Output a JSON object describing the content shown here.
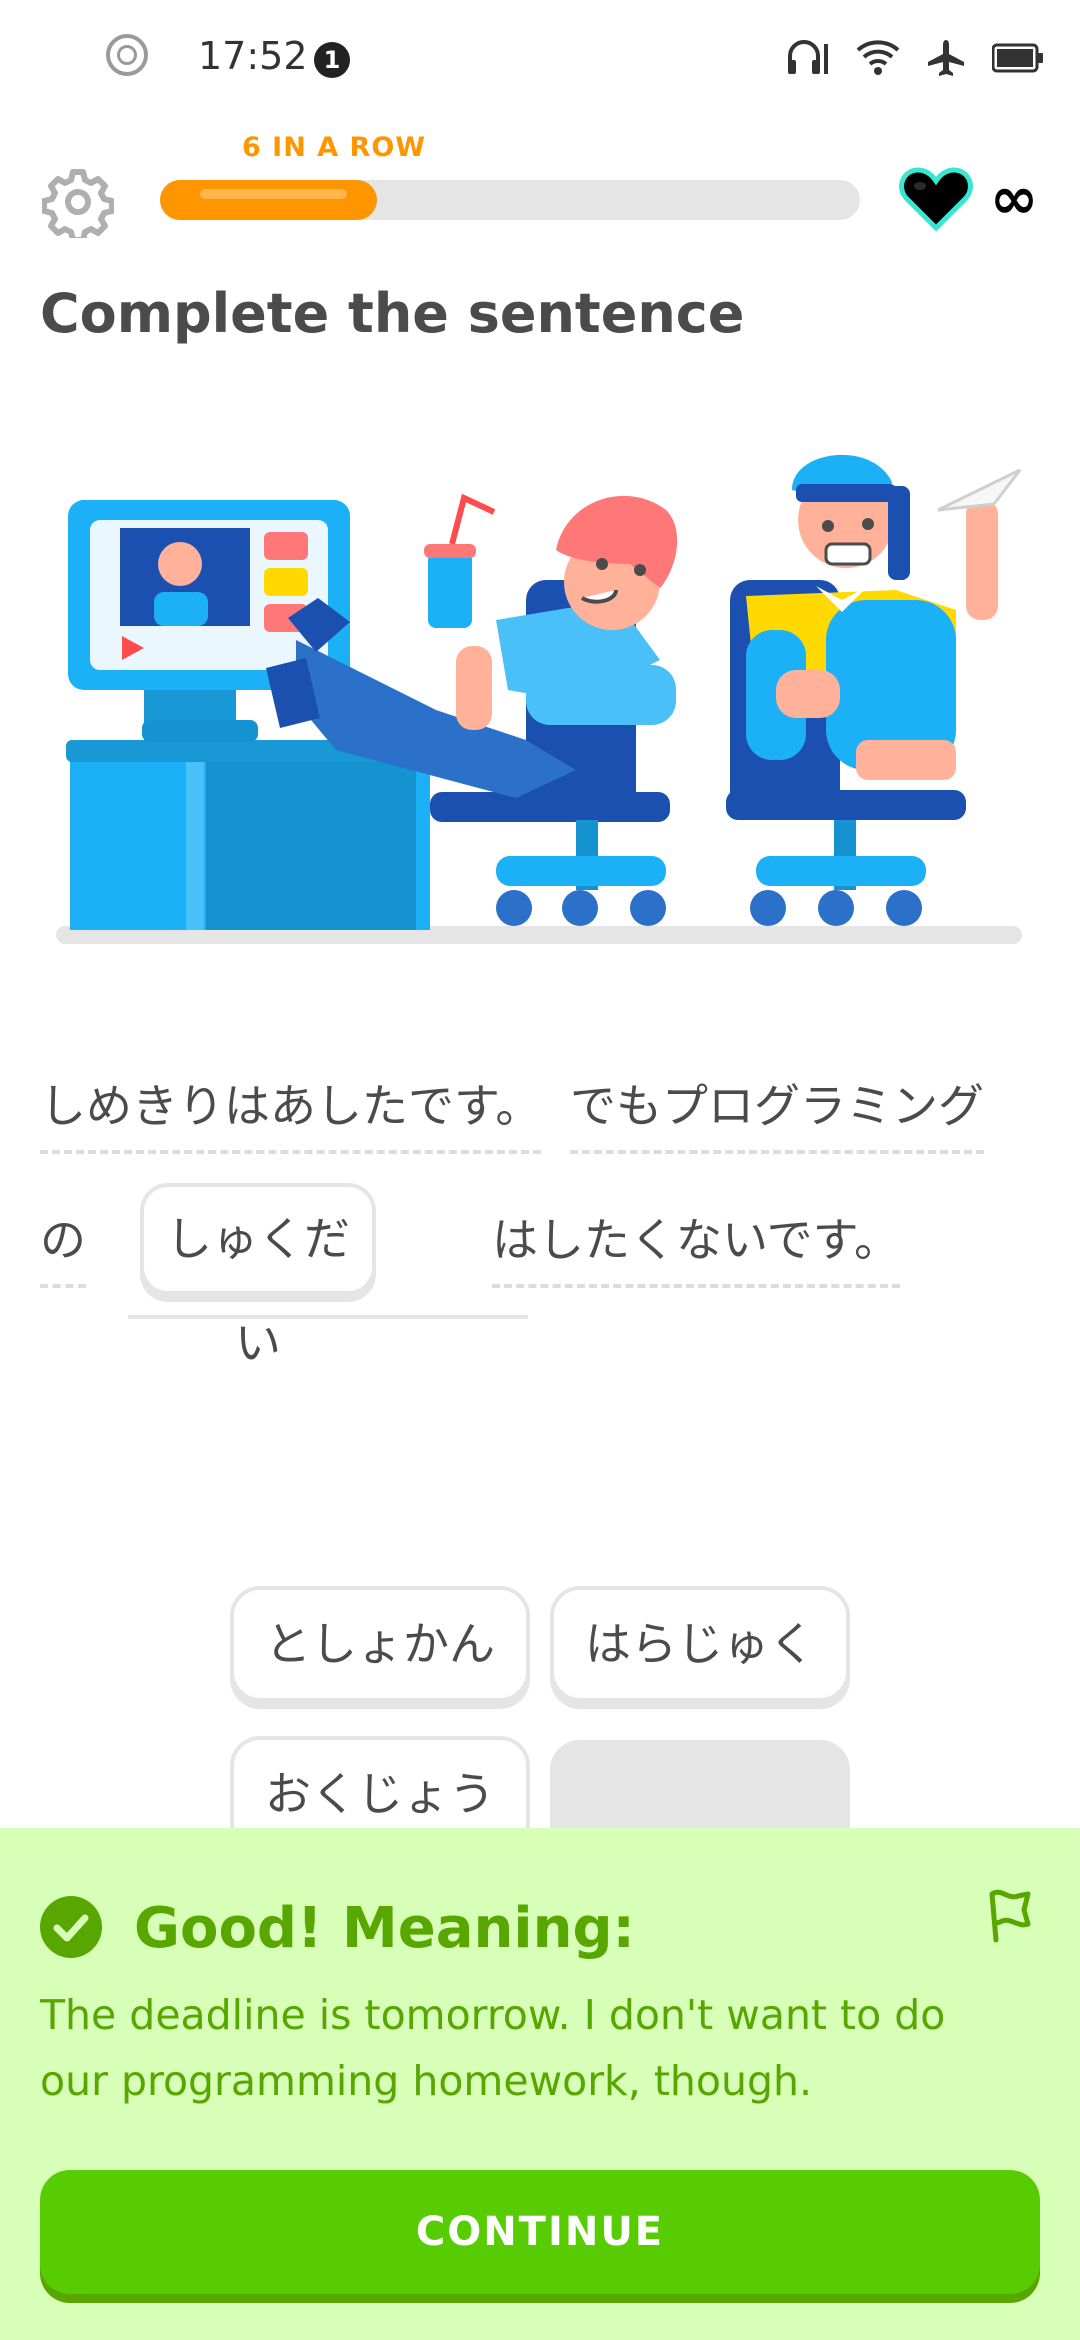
{
  "status_bar": {
    "time": "17:52",
    "notification_count": "1",
    "icons": [
      "circle-icon",
      "headset-signal-icon",
      "wifi-icon",
      "airplane-icon",
      "battery-icon"
    ]
  },
  "header": {
    "streak_label": "6 IN A ROW",
    "progress": 0.31,
    "hearts": "∞",
    "accent_color": "#ff9600"
  },
  "prompt": {
    "title": "Complete the sentence"
  },
  "sentence": {
    "line1_part1": "しめきりはあしたです。",
    "line1_part2": "でもプログラミング",
    "line2_part1": "の",
    "blank_answer": "しゅくだい",
    "line2_part2": "はしたくないです。"
  },
  "word_bank": {
    "options": [
      "としょかん",
      "はらじゅく",
      "おくじょう",
      ""
    ]
  },
  "feedback": {
    "title": "Good! Meaning:",
    "translation": "The deadline is tomorrow. I don't want to do our programming homework, though.",
    "continue_label": "CONTINUE",
    "color": "#58a700"
  }
}
